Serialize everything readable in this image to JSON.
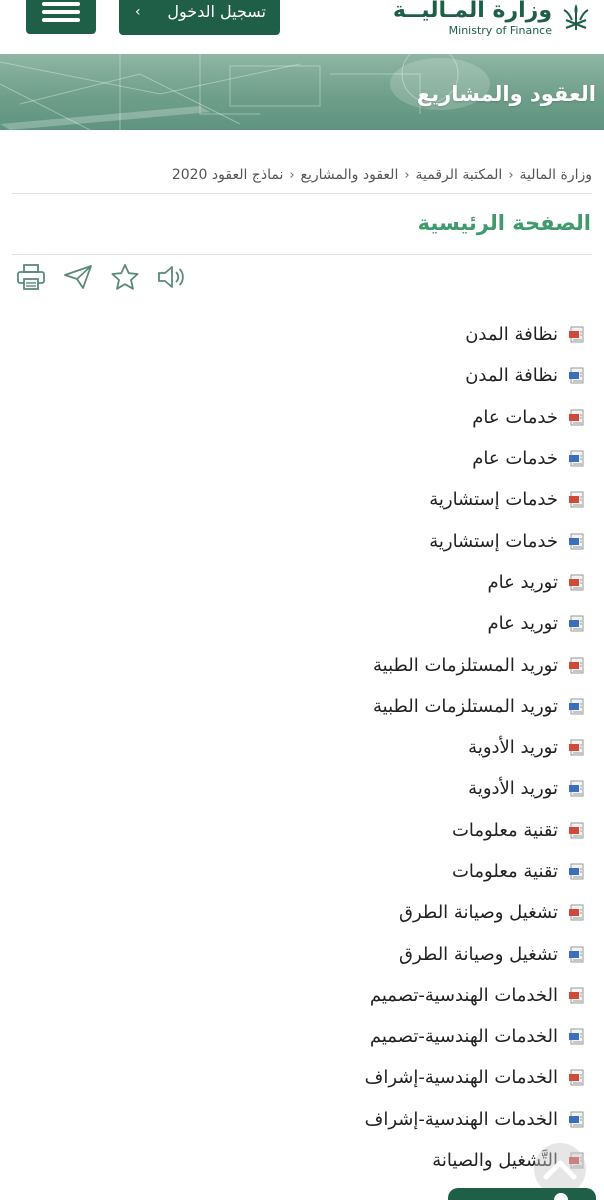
{
  "header": {
    "login_label": "تسجيل الدخول",
    "logo_ar": "وزارة المـاليــة",
    "logo_en": "Ministry of Finance",
    "menu_icon": "hamburger-icon"
  },
  "banner": {
    "title": "العقود والمشاريع"
  },
  "breadcrumb": [
    "وزارة المالية",
    "المكتبة الرقمية",
    "العقود والمشاريع",
    "نماذج العقود 2020"
  ],
  "page_title": "الصفحة الرئيسية",
  "tools": [
    "listen-icon",
    "favorite-star-icon",
    "share-send-icon",
    "print-icon"
  ],
  "files": [
    {
      "label": "نظافة المدن",
      "type": "pdf"
    },
    {
      "label": "نظافة المدن",
      "type": "word"
    },
    {
      "label": "خدمات عام",
      "type": "pdf"
    },
    {
      "label": "خدمات عام",
      "type": "word"
    },
    {
      "label": "خدمات إستشارية",
      "type": "pdf"
    },
    {
      "label": "خدمات إستشارية",
      "type": "word"
    },
    {
      "label": "توريد عام",
      "type": "pdf"
    },
    {
      "label": "توريد عام",
      "type": "word"
    },
    {
      "label": "توريد المستلزمات الطبية",
      "type": "pdf"
    },
    {
      "label": "توريد المستلزمات الطبية",
      "type": "word"
    },
    {
      "label": "توريد الأدوية",
      "type": "pdf"
    },
    {
      "label": "توريد الأدوية",
      "type": "word"
    },
    {
      "label": "تقنية معلومات",
      "type": "pdf"
    },
    {
      "label": "تقنية معلومات",
      "type": "word"
    },
    {
      "label": "تشغيل وصيانة الطرق",
      "type": "pdf"
    },
    {
      "label": "تشغيل وصيانة الطرق",
      "type": "word"
    },
    {
      "label": "الخدمات الهندسية-تصميم",
      "type": "pdf"
    },
    {
      "label": "الخدمات الهندسية-تصميم",
      "type": "word"
    },
    {
      "label": "الخدمات الهندسية-إشراف",
      "type": "pdf"
    },
    {
      "label": "الخدمات الهندسية-إشراف",
      "type": "word"
    },
    {
      "label": "التَّشغيل والصيانة",
      "type": "pdf"
    }
  ],
  "colors": {
    "brand_green": "#1f5f47",
    "title_green": "#3f9a6c",
    "pdf_red": "#d04a3a",
    "word_blue": "#3a6fbf"
  }
}
